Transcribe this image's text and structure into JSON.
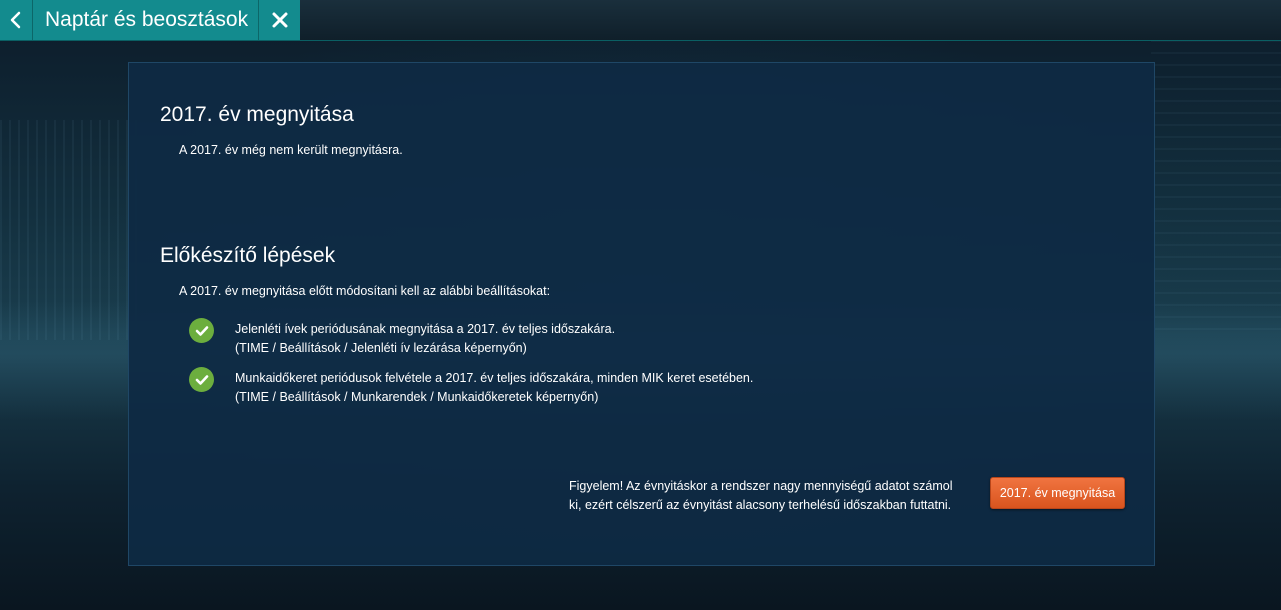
{
  "header": {
    "back_icon": "chevron-left-icon",
    "title": "Naptár és beosztások",
    "close_icon": "close-icon"
  },
  "year_section": {
    "title": "2017. év megnyitása",
    "message": "A 2017. év még nem került megnyitásra."
  },
  "prep_section": {
    "title": "Előkészítő lépések",
    "intro": "A 2017. év megnyitása előtt módosítani kell az alábbi beállításokat:",
    "steps": [
      {
        "status_icon": "check-circle-icon",
        "line1": "Jelenléti ívek periódusának megnyitása a 2017. év teljes időszakára.",
        "line2": "(TIME / Beállítások / Jelenléti ív lezárása képernyőn)"
      },
      {
        "status_icon": "check-circle-icon",
        "line1": "Munkaidőkeret periódusok felvétele a 2017. év teljes időszakára, minden MIK keret esetében.",
        "line2": "(TIME / Beállítások / Munkarendek / Munkaidőkeretek képernyőn)"
      }
    ]
  },
  "footer": {
    "warning_line1": "Figyelem! Az évnyitáskor a rendszer nagy mennyiségű adatot számol",
    "warning_line2": "ki, ezért célszerű az évnyitást alacsony terhelésű időszakban futtatni.",
    "open_button_label": "2017. év megnyitása"
  },
  "colors": {
    "tab_accent": "#138b8e",
    "check_green": "#6cae3e",
    "button_orange": "#e4602b",
    "panel_bg": "#0e2a44"
  }
}
